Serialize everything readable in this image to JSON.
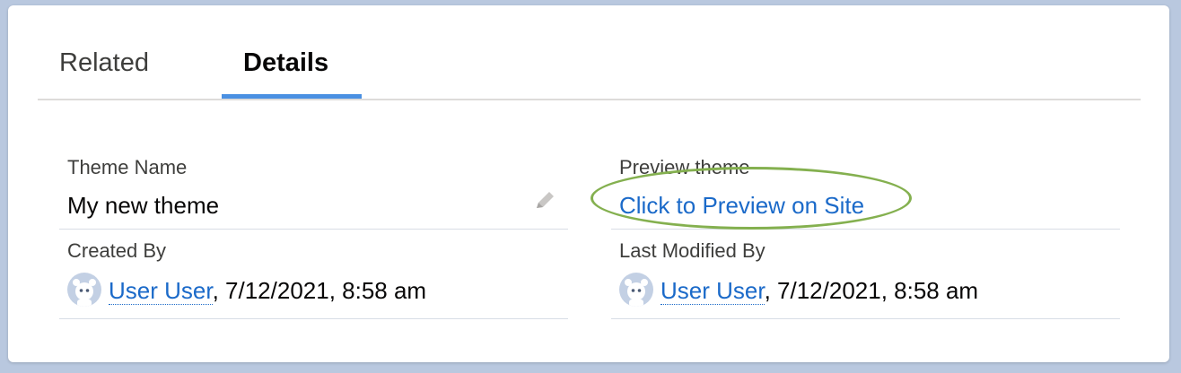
{
  "tabs": [
    {
      "label": "Related",
      "active": false
    },
    {
      "label": "Details",
      "active": true
    }
  ],
  "fields": {
    "theme_name": {
      "label": "Theme Name",
      "value": "My new theme",
      "icon": "pencil-icon"
    },
    "preview_theme": {
      "label": "Preview theme",
      "link": "Click to Preview on Site"
    },
    "created_by": {
      "label": "Created By",
      "user": "User User",
      "timestamp": ", 7/12/2021, 8:58 am"
    },
    "last_modified_by": {
      "label": "Last Modified By",
      "user": "User User",
      "timestamp": ", 7/12/2021, 8:58 am"
    }
  },
  "colors": {
    "link": "#1b6ac9",
    "tab_underline": "#4a90e2",
    "highlight_ring": "#84b04f"
  }
}
